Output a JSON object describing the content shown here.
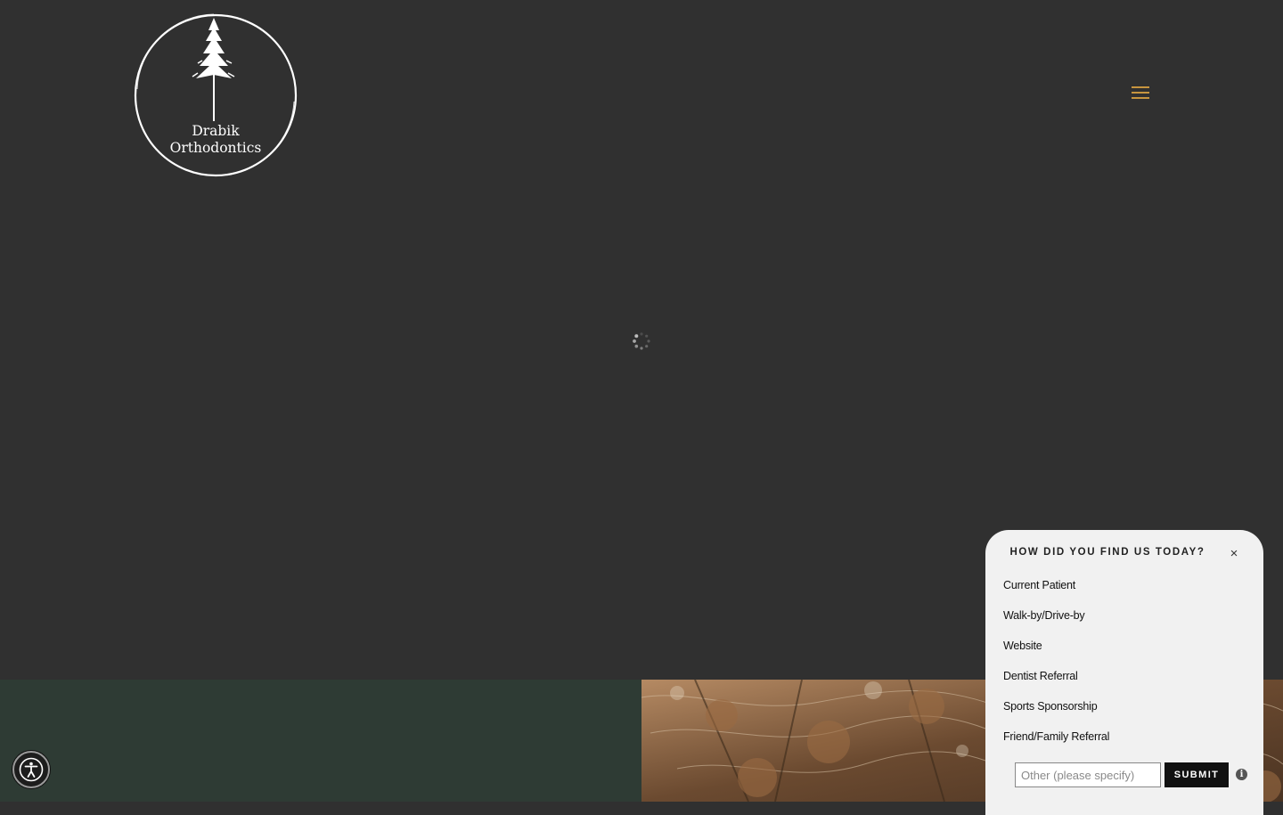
{
  "brand": {
    "logo_line1": "Drabik",
    "logo_line2": "Orthodontics"
  },
  "header": {
    "menu_icon": "hamburger-menu-icon",
    "menu_color": "#c7953f"
  },
  "main": {
    "loading_icon": "spinner-icon"
  },
  "accessibility": {
    "icon": "accessibility-icon"
  },
  "survey": {
    "title": "HOW DID YOU FIND US TODAY?",
    "close_label": "×",
    "options": [
      "Current Patient",
      "Walk-by/Drive-by",
      "Website",
      "Dentist Referral",
      "Sports Sponsorship",
      "Friend/Family Referral"
    ],
    "other_placeholder": "Other (please specify)",
    "other_value": "",
    "submit_label": "SUBMIT",
    "info_label": "i"
  },
  "colors": {
    "page_background": "#303030",
    "footer_green": "#2e3b34",
    "accent_gold": "#c7953f",
    "survey_background": "#f1f1f1"
  }
}
